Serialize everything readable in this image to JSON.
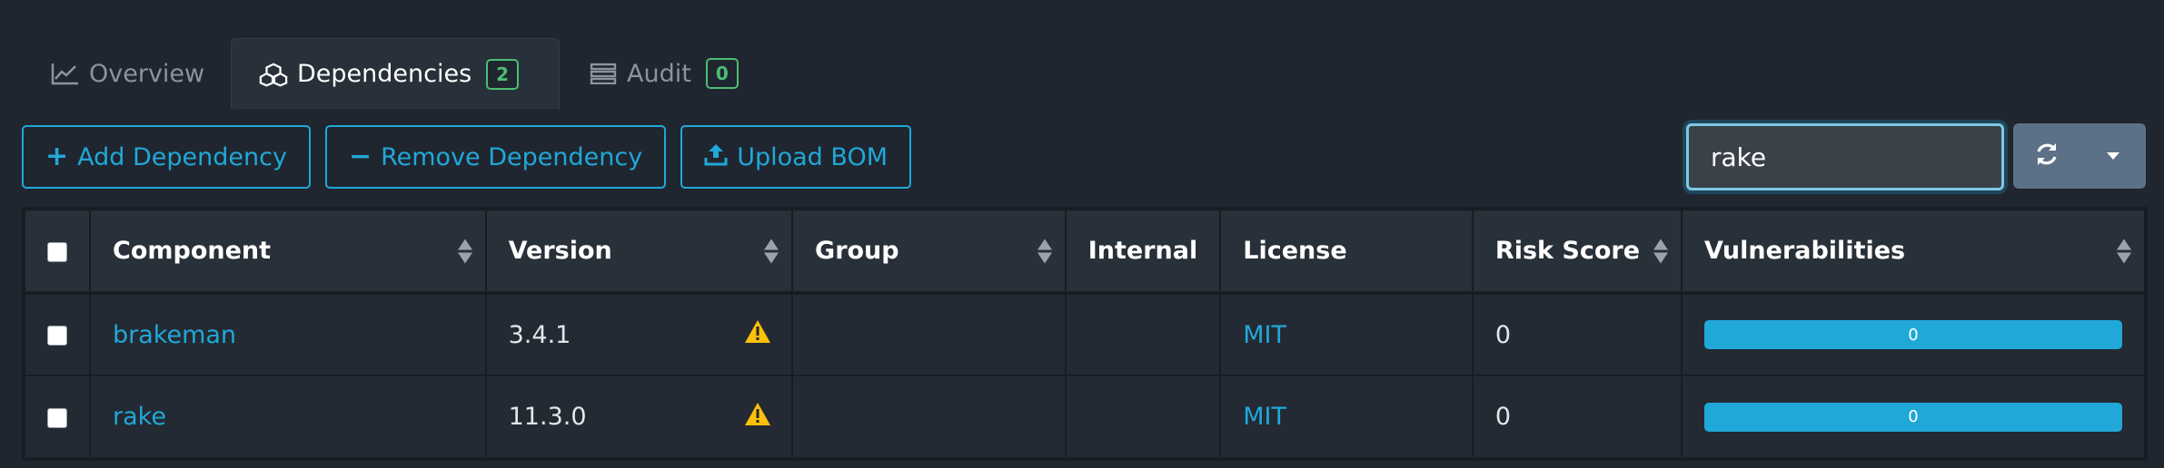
{
  "tabs": [
    {
      "label": "Overview",
      "icon": "line-chart-icon",
      "active": false
    },
    {
      "label": "Dependencies",
      "icon": "cubes-icon",
      "active": true,
      "badge": "2"
    },
    {
      "label": "Audit",
      "icon": "tasks-icon",
      "active": false,
      "badge": "0"
    }
  ],
  "toolbar": {
    "add_label": "Add Dependency",
    "remove_label": "Remove Dependency",
    "upload_label": "Upload BOM"
  },
  "search": {
    "value": "rake",
    "placeholder": "Search"
  },
  "table": {
    "columns": [
      "Component",
      "Version",
      "Group",
      "Internal",
      "License",
      "Risk Score",
      "Vulnerabilities"
    ],
    "rows": [
      {
        "component": "brakeman",
        "version": "3.4.1",
        "group": "",
        "internal": "",
        "license": "MIT",
        "risk_score": "0",
        "vulnerabilities": "0"
      },
      {
        "component": "rake",
        "version": "11.3.0",
        "group": "",
        "internal": "",
        "license": "MIT",
        "risk_score": "0",
        "vulnerabilities": "0"
      }
    ]
  },
  "colors": {
    "accent": "#20a8d8",
    "badge": "#4dbd74",
    "warning": "#ffc107",
    "background": "#1f2630"
  }
}
